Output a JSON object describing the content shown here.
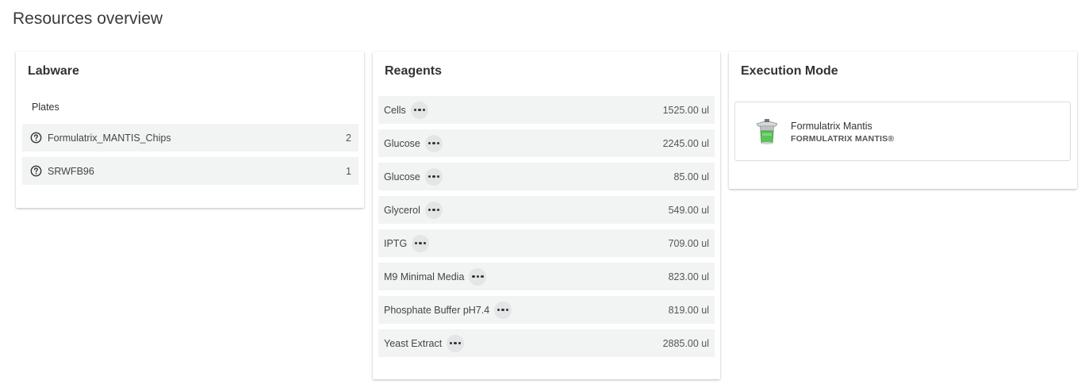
{
  "page": {
    "title": "Resources overview"
  },
  "labware": {
    "title": "Labware",
    "section": "Plates",
    "items": [
      {
        "icon": "help-circle-icon",
        "name": "Formulatrix_MANTIS_Chips",
        "count": "2"
      },
      {
        "icon": "help-circle-icon",
        "name": "SRWFB96",
        "count": "1"
      }
    ]
  },
  "reagents": {
    "title": "Reagents",
    "items": [
      {
        "name": "Cells",
        "amount": "1525.00 ul"
      },
      {
        "name": "Glucose",
        "amount": "2245.00 ul"
      },
      {
        "name": "Glucose",
        "amount": "85.00 ul"
      },
      {
        "name": "Glycerol",
        "amount": "549.00 ul"
      },
      {
        "name": "IPTG",
        "amount": "709.00 ul"
      },
      {
        "name": "M9 Minimal Media",
        "amount": "823.00 ul"
      },
      {
        "name": "Phosphate Buffer pH7.4",
        "amount": "819.00 ul"
      },
      {
        "name": "Yeast Extract",
        "amount": "2885.00 ul"
      }
    ]
  },
  "execution": {
    "title": "Execution Mode",
    "device": {
      "icon": "liquid-dispenser-icon",
      "name": "Formulatrix Mantis",
      "model": "FORMULATRIX MANTIS®"
    }
  },
  "colors": {
    "row_background": "#f2f4f4",
    "more_button": "#e3e5e6",
    "device_accent": "#5cc25a"
  }
}
